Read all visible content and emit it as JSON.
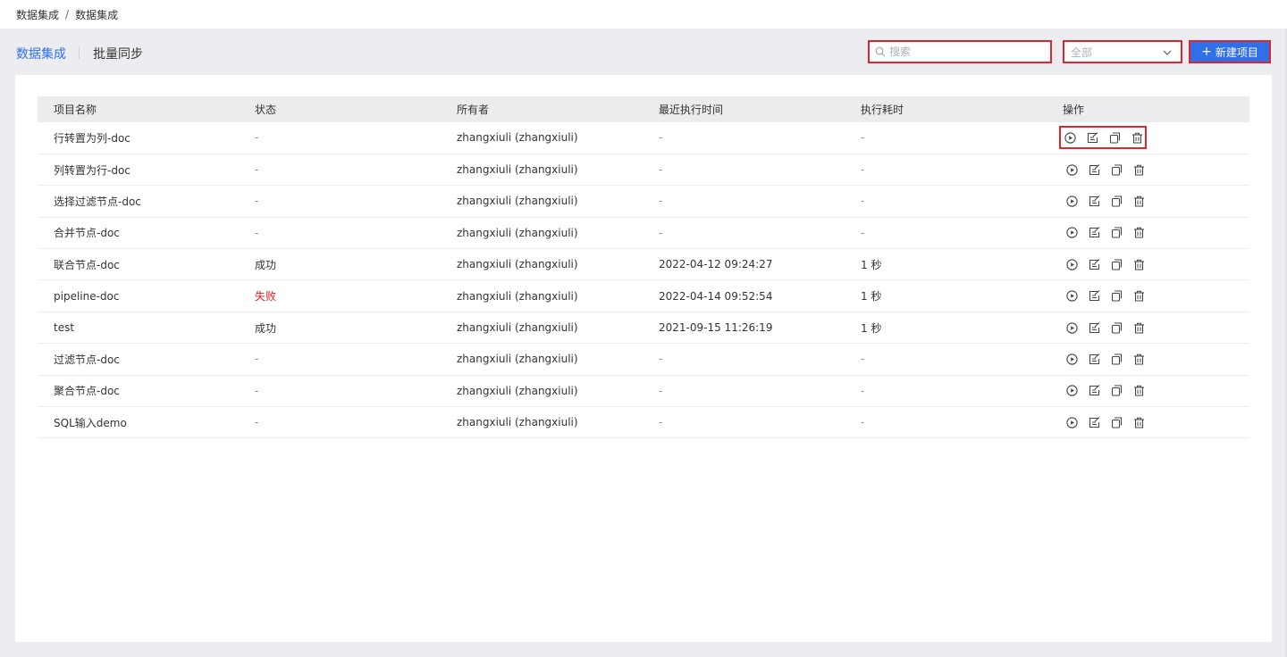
{
  "breadcrumb": {
    "root": "数据集成",
    "separator": "/",
    "current": "数据集成"
  },
  "tabs": [
    {
      "label": "数据集成",
      "active": true
    },
    {
      "label": "批量同步",
      "active": false
    }
  ],
  "search": {
    "placeholder": "搜索",
    "value": ""
  },
  "filter": {
    "selected": "全部"
  },
  "new_button": {
    "label": "新建项目",
    "icon": "plus-icon"
  },
  "colors": {
    "accent": "#2f6fe8",
    "error": "#d81e24",
    "highlight": "#e5232a"
  },
  "table": {
    "headers": [
      "项目名称",
      "状态",
      "所有者",
      "最近执行时间",
      "执行耗时",
      "操作"
    ],
    "action_icons": [
      "play-icon",
      "edit-icon",
      "copy-icon",
      "delete-icon"
    ],
    "rows": [
      {
        "name": "行转置为列-doc",
        "status": "-",
        "owner": "zhangxiuli (zhangxiuli)",
        "last_run": "-",
        "duration": "-"
      },
      {
        "name": "列转置为行-doc",
        "status": "-",
        "owner": "zhangxiuli (zhangxiuli)",
        "last_run": "-",
        "duration": "-"
      },
      {
        "name": "选择过滤节点-doc",
        "status": "-",
        "owner": "zhangxiuli (zhangxiuli)",
        "last_run": "-",
        "duration": "-"
      },
      {
        "name": "合并节点-doc",
        "status": "-",
        "owner": "zhangxiuli (zhangxiuli)",
        "last_run": "-",
        "duration": "-"
      },
      {
        "name": "联合节点-doc",
        "status": "成功",
        "owner": "zhangxiuli (zhangxiuli)",
        "last_run": "2022-04-12 09:24:27",
        "duration": "1 秒"
      },
      {
        "name": "pipeline-doc",
        "status": "失败",
        "owner": "zhangxiuli (zhangxiuli)",
        "last_run": "2022-04-14 09:52:54",
        "duration": "1 秒"
      },
      {
        "name": "test",
        "status": "成功",
        "owner": "zhangxiuli (zhangxiuli)",
        "last_run": "2021-09-15 11:26:19",
        "duration": "1 秒"
      },
      {
        "name": "过滤节点-doc",
        "status": "-",
        "owner": "zhangxiuli (zhangxiuli)",
        "last_run": "-",
        "duration": "-"
      },
      {
        "name": "聚合节点-doc",
        "status": "-",
        "owner": "zhangxiuli (zhangxiuli)",
        "last_run": "-",
        "duration": "-"
      },
      {
        "name": "SQL输入demo",
        "status": "-",
        "owner": "zhangxiuli (zhangxiuli)",
        "last_run": "-",
        "duration": "-"
      }
    ]
  }
}
